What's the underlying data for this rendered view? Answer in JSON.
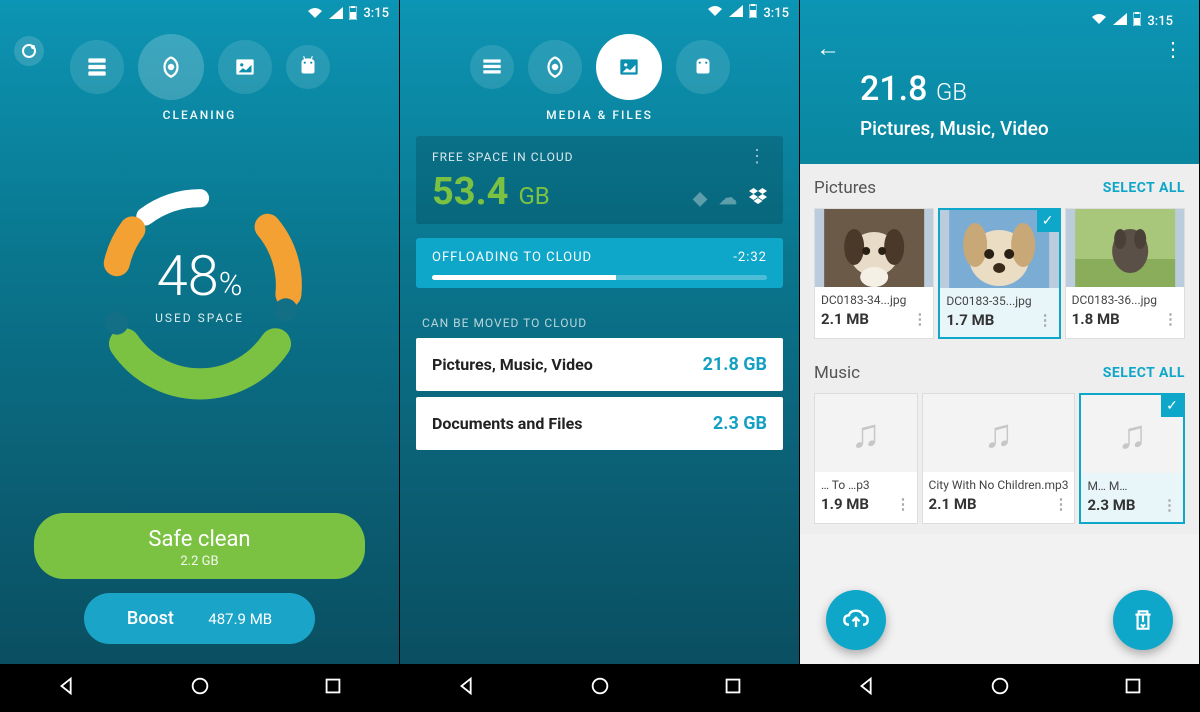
{
  "status": {
    "time": "3:15"
  },
  "screen1": {
    "nav_label": "CLEANING",
    "percent": "48",
    "percent_unit": "%",
    "used_label": "USED SPACE",
    "safe_clean_label": "Safe clean",
    "safe_clean_size": "2.2 GB",
    "boost_label": "Boost",
    "boost_size": "487.9 MB"
  },
  "screen2": {
    "nav_label": "MEDIA & FILES",
    "free_label": "FREE SPACE IN CLOUD",
    "free_value": "53.4",
    "free_unit": "GB",
    "offload_label": "OFFLOADING TO CLOUD",
    "offload_time": "-2:32",
    "move_label": "CAN BE MOVED TO CLOUD",
    "rows": [
      {
        "name": "Pictures, Music, Video",
        "size": "21.8 GB"
      },
      {
        "name": "Documents and Files",
        "size": "2.3 GB"
      }
    ]
  },
  "screen3": {
    "title_value": "21.8",
    "title_unit": "GB",
    "subtitle": "Pictures, Music, Video",
    "pictures_label": "Pictures",
    "music_label": "Music",
    "select_all": "SELECT ALL",
    "pics": [
      {
        "fn": "DC0183-34...jpg",
        "sz": "2.1 MB"
      },
      {
        "fn": "DC0183-35...jpg",
        "sz": "1.7 MB"
      },
      {
        "fn": "DC0183-36...jpg",
        "sz": "1.8 MB"
      }
    ],
    "music": [
      {
        "fn": "… To …p3",
        "sz": "1.9 MB"
      },
      {
        "fn": "City With No Children.mp3",
        "sz": "2.1 MB"
      },
      {
        "fn": "M… M…",
        "sz": "2.3 MB"
      }
    ]
  }
}
